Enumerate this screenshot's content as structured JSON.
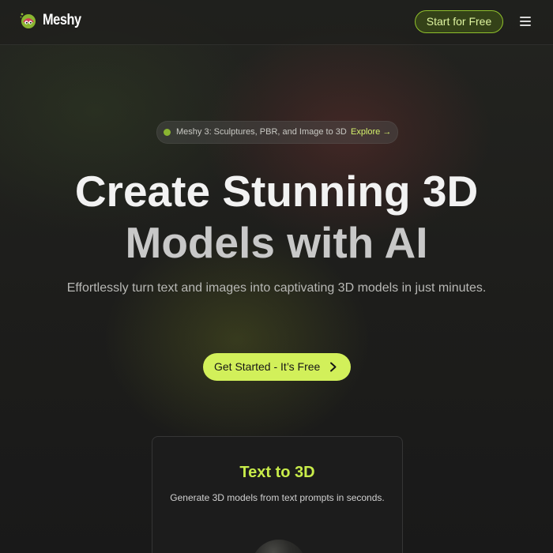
{
  "header": {
    "brand": "Meshy",
    "start_label": "Start for Free"
  },
  "announcement": {
    "text": "Meshy 3: Sculptures, PBR, and Image to 3D",
    "link_label": "Explore →"
  },
  "hero": {
    "title_line1": "Create Stunning 3D",
    "title_line2": "Models with AI",
    "subtitle": "Effortlessly turn text and images into captivating 3D models in just minutes.",
    "cta_label": "Get Started - It’s Free"
  },
  "feature_card": {
    "title": "Text to 3D",
    "description": "Generate 3D models from text prompts in seconds."
  },
  "colors": {
    "accent": "#d2f05a",
    "background": "#1a1a1a",
    "brand_green": "#8ab531"
  },
  "icons": {
    "logo": "meshy-logo-icon",
    "menu": "hamburger-menu-icon",
    "cta_arrow": "chevron-right-icon"
  }
}
